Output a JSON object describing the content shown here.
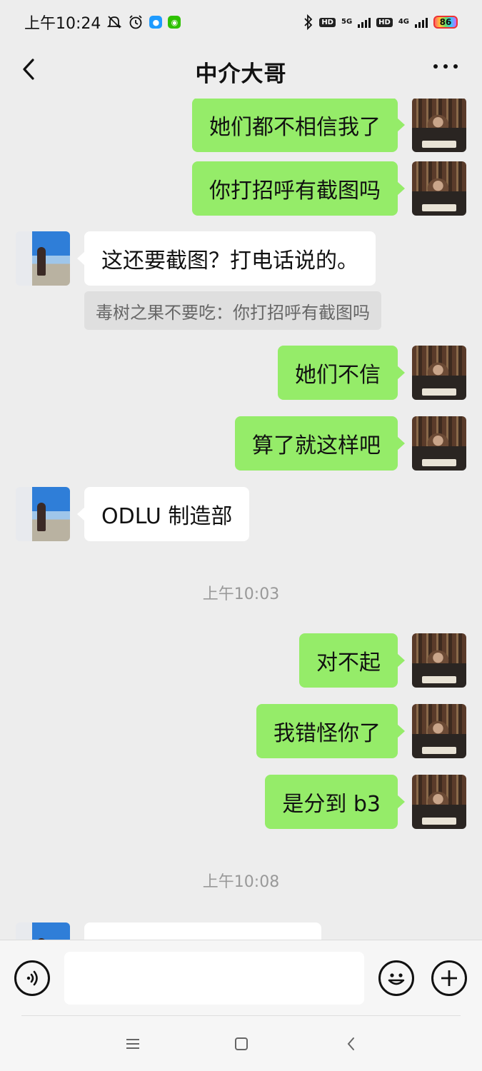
{
  "status_bar": {
    "time": "上午10:24",
    "hd1": "HD",
    "net1": "5G",
    "hd2": "HD",
    "net2": "4G",
    "battery": "86"
  },
  "header": {
    "title": "中介大哥"
  },
  "messages": [
    {
      "side": "self",
      "text": "她们都不相信我了"
    },
    {
      "side": "self",
      "text": "你打招呼有截图吗"
    },
    {
      "side": "other",
      "text": "这还要截图？打电话说的。",
      "quote": "毒树之果不要吃：你打招呼有截图吗"
    },
    {
      "side": "self",
      "text": "她们不信"
    },
    {
      "side": "self",
      "text": "算了就这样吧"
    },
    {
      "side": "other",
      "text": "ODLU 制造部"
    },
    {
      "type": "time",
      "text": "上午10:03"
    },
    {
      "side": "self",
      "text": "对不起"
    },
    {
      "side": "self",
      "text": "我错怪你了"
    },
    {
      "side": "self",
      "text": "是分到 b3"
    },
    {
      "type": "time",
      "text": "上午10:08"
    },
    {
      "side": "other",
      "text": ""
    }
  ],
  "input": {
    "value": "",
    "placeholder": ""
  },
  "icons": {
    "back": "chevron-left-icon",
    "more": "more-dots-icon",
    "voice": "voice-icon",
    "emoji": "emoji-icon",
    "plus": "plus-icon"
  },
  "colors": {
    "self_bubble": "#95ec69",
    "other_bubble": "#ffffff",
    "background": "#ededed"
  }
}
